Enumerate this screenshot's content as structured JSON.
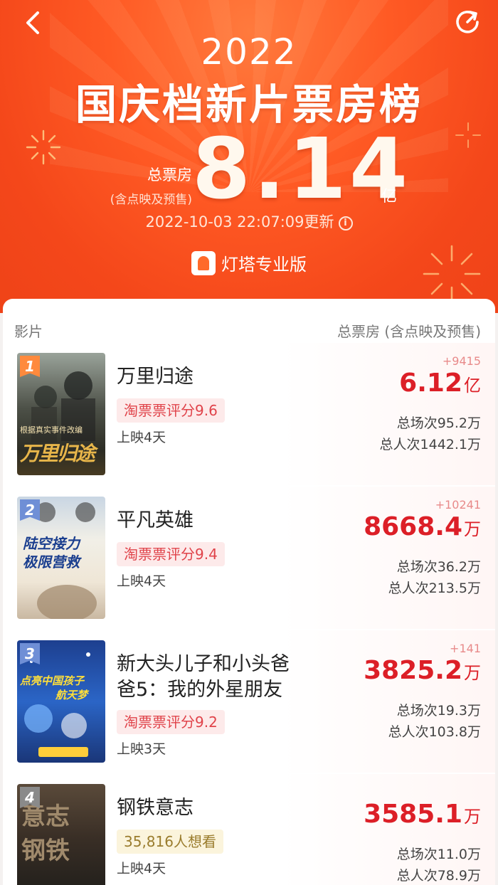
{
  "header": {
    "year": "2022",
    "title": "国庆档新片票房榜",
    "total_label": "总票房",
    "total_sublabel": "(含点映及预售)",
    "total_value": "8.14",
    "total_unit": "亿",
    "update_time": "2022-10-03 22:07:09更新",
    "brand": "灯塔专业版"
  },
  "columns": {
    "film": "影片",
    "gross": "总票房 (含点映及预售)"
  },
  "movies": [
    {
      "rank": "1",
      "name_line1": "万里归途",
      "name_line2": "",
      "tag": "淘票票评分9.6",
      "days": "上映4天",
      "delta": "+9415",
      "gross": "6.12",
      "gross_unit": "亿",
      "screenings": "总场次95.2万",
      "admissions": "总人次1442.1万",
      "poster_text": "万里归途",
      "poster_top": "根据真实事件改编"
    },
    {
      "rank": "2",
      "name_line1": "平凡英雄",
      "name_line2": "",
      "tag": "淘票票评分9.4",
      "days": "上映4天",
      "delta": "+10241",
      "gross": "8668.4",
      "gross_unit": "万",
      "screenings": "总场次36.2万",
      "admissions": "总人次213.5万",
      "poster_text": "陆空接力",
      "poster_top": "极限营救"
    },
    {
      "rank": "3",
      "name_line1": "新大头儿子和小头爸",
      "name_line2": "爸5：我的外星朋友",
      "tag": "淘票票评分9.2",
      "days": "上映3天",
      "delta": "+141",
      "gross": "3825.2",
      "gross_unit": "万",
      "screenings": "总场次19.3万",
      "admissions": "总人次103.8万",
      "poster_text": "点亮中国孩子",
      "poster_top": "航天梦"
    },
    {
      "rank": "4",
      "name_line1": "钢铁意志",
      "name_line2": "",
      "tag": "35,816人想看",
      "days": "上映4天",
      "delta": "",
      "gross": "3585.1",
      "gross_unit": "万",
      "screenings": "总场次11.0万",
      "admissions": "总人次78.9万",
      "poster_text": "钢铁",
      "poster_top": "意志"
    }
  ],
  "colors": {
    "header_bg": "#f4471a",
    "gross_red": "#dc1f27",
    "rank1": "#ff8a3d",
    "rank2": "#6f8fd6",
    "rank3": "#6f8fd6",
    "rank4": "#8a8a8a"
  },
  "icons": {
    "back": "chevron-left-icon",
    "share": "share-icon",
    "info": "info-icon",
    "brand": "lighthouse-logo-icon"
  }
}
